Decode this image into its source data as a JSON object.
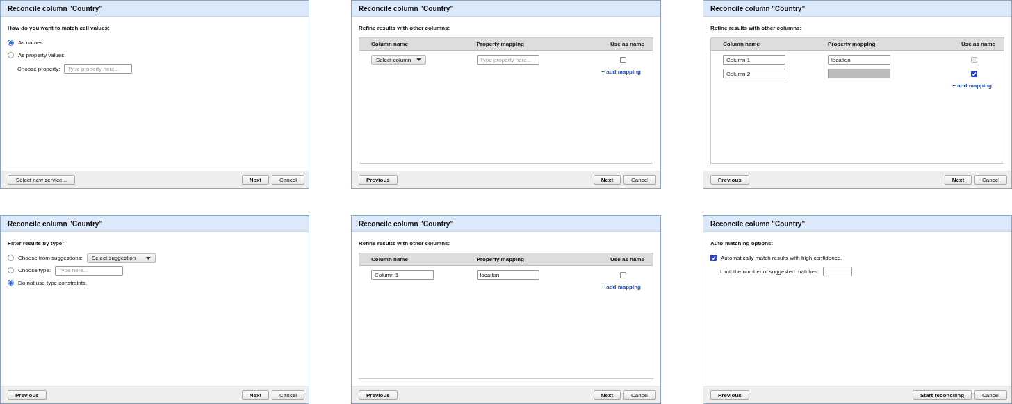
{
  "dialogs": [
    {
      "title": "Reconcile column \"Country\"",
      "heading": "How do you want to match cell values:",
      "body": {
        "kind": "options",
        "items": [
          {
            "kind": "radio",
            "label": "As names.",
            "selected": true
          },
          {
            "kind": "radio",
            "label": "As property values.",
            "selected": false
          },
          {
            "kind": "labeled-field",
            "label": "Choose property:",
            "control": {
              "kind": "field",
              "placeholder": "Type property here..."
            }
          }
        ]
      },
      "left_button": {
        "label": "Select new service...",
        "primary": false
      },
      "right_buttons": [
        {
          "label": "Next",
          "primary": true
        },
        {
          "label": "Cancel",
          "primary": false
        }
      ]
    },
    {
      "title": "Reconcile column \"Country\"",
      "heading": "Refine results with other columns:",
      "body": {
        "kind": "mapping",
        "columns": [
          "Column name",
          "Property mapping",
          "Use as name"
        ],
        "rows": [
          {
            "column": {
              "kind": "dropdown",
              "text": "Select column"
            },
            "property": {
              "kind": "field",
              "placeholder": "Type property here...",
              "disabled": false
            },
            "use_as_name": {
              "checked": false,
              "disabled": false
            }
          }
        ],
        "add_link": "+ add mapping"
      },
      "left_button": {
        "label": "Previous",
        "primary": true
      },
      "right_buttons": [
        {
          "label": "Next",
          "primary": true
        },
        {
          "label": "Cancel",
          "primary": false
        }
      ]
    },
    {
      "title": "Reconcile column \"Country\"",
      "heading": "Refine results with other columns:",
      "body": {
        "kind": "mapping",
        "columns": [
          "Column name",
          "Property mapping",
          "Use as name"
        ],
        "rows": [
          {
            "column": {
              "kind": "field",
              "value": "Column 1"
            },
            "property": {
              "kind": "field",
              "value": "location",
              "disabled": false
            },
            "use_as_name": {
              "checked": false,
              "disabled": true
            }
          },
          {
            "column": {
              "kind": "field",
              "value": "Column 2"
            },
            "property": {
              "kind": "field",
              "disabled": true
            },
            "use_as_name": {
              "checked": true,
              "disabled": false
            }
          }
        ],
        "add_link": "+ add mapping"
      },
      "left_button": {
        "label": "Previous",
        "primary": true
      },
      "right_buttons": [
        {
          "label": "Next",
          "primary": true
        },
        {
          "label": "Cancel",
          "primary": false
        }
      ]
    },
    {
      "title": "Reconcile column \"Country\"",
      "heading": "Filter results by type:",
      "body": {
        "kind": "options",
        "items": [
          {
            "kind": "radio",
            "label": "Choose from suggestions:",
            "selected": false,
            "control": {
              "kind": "dropdown",
              "text": "Select suggestion"
            }
          },
          {
            "kind": "radio",
            "label": "Choose type:",
            "selected": false,
            "control": {
              "kind": "field",
              "placeholder": "Type here..."
            }
          },
          {
            "kind": "radio",
            "label": "Do not use type constraints.",
            "selected": true
          }
        ]
      },
      "left_button": {
        "label": "Previous",
        "primary": true
      },
      "right_buttons": [
        {
          "label": "Next",
          "primary": true
        },
        {
          "label": "Cancel",
          "primary": false
        }
      ]
    },
    {
      "title": "Reconcile column \"Country\"",
      "heading": "Refine results with other columns:",
      "body": {
        "kind": "mapping",
        "columns": [
          "Column name",
          "Property mapping",
          "Use as name"
        ],
        "rows": [
          {
            "column": {
              "kind": "field",
              "value": "Column 1"
            },
            "property": {
              "kind": "field",
              "value": "location",
              "disabled": false
            },
            "use_as_name": {
              "checked": false,
              "disabled": false
            }
          }
        ],
        "add_link": "+ add mapping"
      },
      "left_button": {
        "label": "Previous",
        "primary": true
      },
      "right_buttons": [
        {
          "label": "Next",
          "primary": true
        },
        {
          "label": "Cancel",
          "primary": false
        }
      ]
    },
    {
      "title": "Reconcile column \"Country\"",
      "heading": "Auto-matching options:",
      "body": {
        "kind": "options",
        "items": [
          {
            "kind": "checkbox",
            "label": "Automatically match results with high confidence.",
            "checked": true
          },
          {
            "kind": "labeled-field",
            "label": "Limit the number of suggested matches:",
            "control": {
              "kind": "number-field"
            }
          }
        ]
      },
      "left_button": {
        "label": "Previous",
        "primary": true
      },
      "right_buttons": [
        {
          "label": "Start reconciling",
          "primary": true
        },
        {
          "label": "Cancel",
          "primary": false
        }
      ]
    }
  ]
}
